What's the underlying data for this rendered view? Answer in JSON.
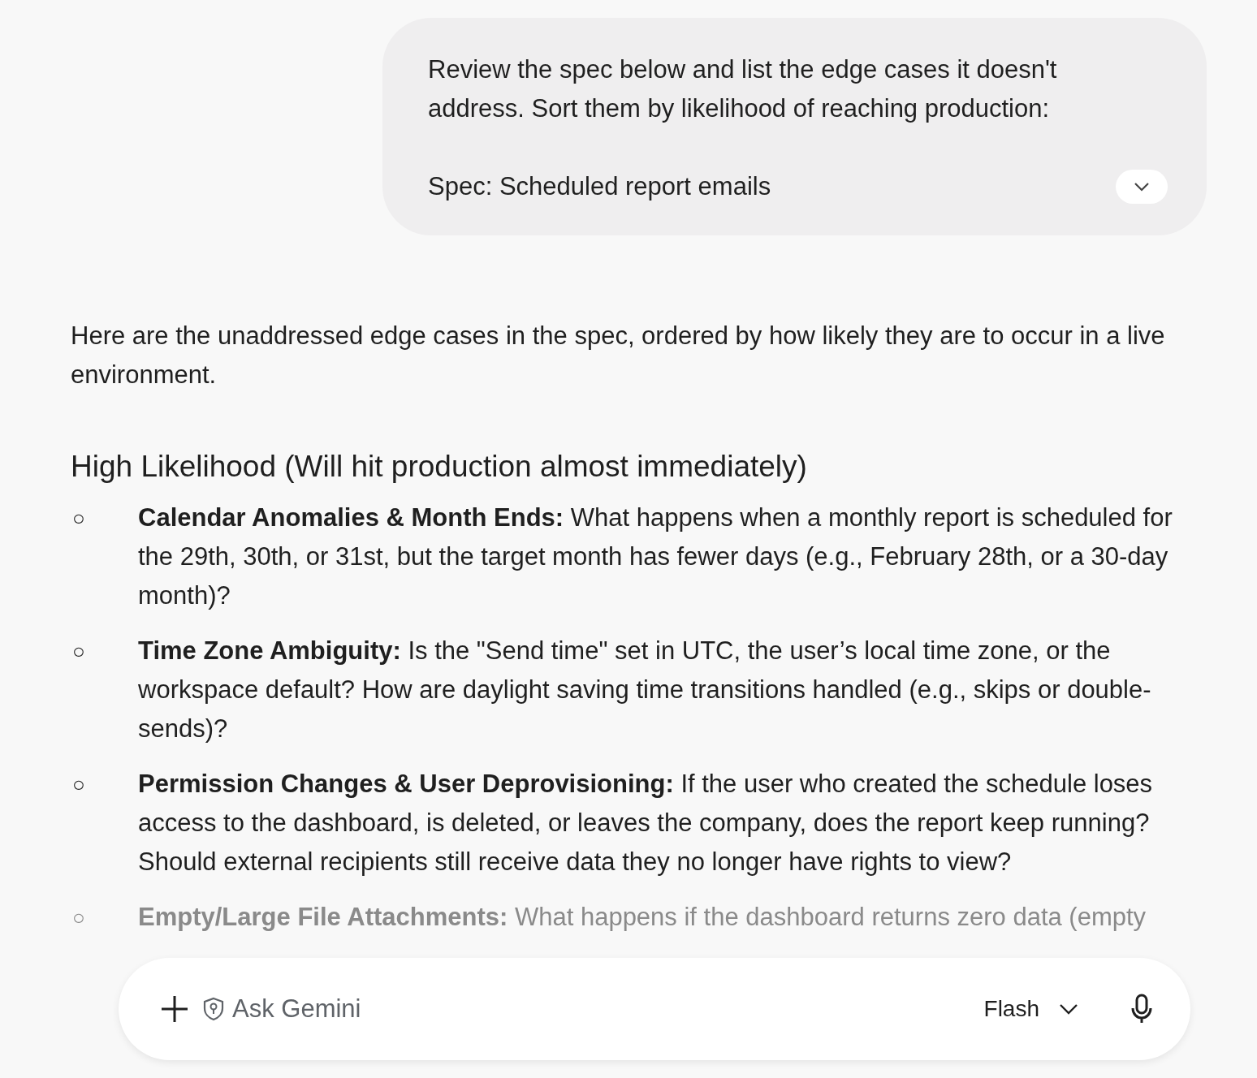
{
  "user_message": {
    "paragraphs": [
      "Review the spec below and list the edge cases it doesn't address. Sort them by likelihood of reaching production:",
      "Spec: Scheduled report emails"
    ],
    "expanded": false
  },
  "response": {
    "intro": "Here are the unaddressed edge cases in the spec, ordered by how likely they are to occur in a live environment.",
    "heading": "High Likelihood (Will hit production almost immediately)",
    "items": [
      {
        "bullet": "○",
        "title": "Calendar Anomalies & Month Ends:",
        "text": "What happens when a monthly report is scheduled for the 29th, 30th, or 31st, but the target month has fewer days (e.g., February 28th, or a 30-day month)?",
        "faded": false
      },
      {
        "bullet": "○",
        "title": "Time Zone Ambiguity:",
        "text": "Is the \"Send time\" set in UTC, the user’s local time zone, or the workspace default? How are daylight saving time transitions handled (e.g., skips or double-sends)?",
        "faded": false
      },
      {
        "bullet": "○",
        "title": "Permission Changes & User Deprovisioning:",
        "text": "If the user who created the schedule loses access to the dashboard, is deleted, or leaves the company, does the report keep running? Should external recipients still receive data they no longer have rights to view?",
        "faded": false
      },
      {
        "bullet": "○",
        "title": "Empty/Large File Attachments:",
        "text": "What happens if the dashboard returns zero data (empty",
        "faded": true
      }
    ]
  },
  "composer": {
    "placeholder": "Ask Gemini",
    "model": "Flash"
  }
}
